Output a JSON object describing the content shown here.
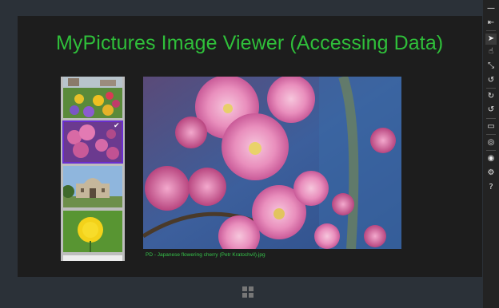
{
  "app": {
    "title": "MyPictures Image Viewer (Accessing Data)",
    "caption": "PD - Japanese flowering cherry (Petr Kratochvil).jpg"
  },
  "thumbnails": [
    {
      "name": "thumb-flower-garden",
      "selected": false
    },
    {
      "name": "thumb-japanese-cherry",
      "selected": true
    },
    {
      "name": "thumb-alamo-building",
      "selected": false
    },
    {
      "name": "thumb-yellow-dandelion",
      "selected": false
    }
  ],
  "toolbar": {
    "items": [
      {
        "name": "minimize-icon",
        "glyph": "—"
      },
      {
        "name": "pin-icon",
        "glyph": "⇤"
      },
      {
        "name": "pointer-icon",
        "glyph": "➤"
      },
      {
        "name": "touch-icon",
        "glyph": "☝"
      },
      {
        "name": "pinch-icon",
        "glyph": "⤡"
      },
      {
        "name": "rotate-touch-icon",
        "glyph": "↺"
      },
      {
        "name": "rotate-clockwise-icon",
        "glyph": "↻"
      },
      {
        "name": "rotate-counterclockwise-icon",
        "glyph": "↺"
      },
      {
        "name": "resolution-icon",
        "glyph": "▭"
      },
      {
        "name": "location-icon",
        "glyph": "◎"
      },
      {
        "name": "camera-icon",
        "glyph": "◉"
      },
      {
        "name": "settings-icon",
        "glyph": "⚙"
      },
      {
        "name": "help-icon",
        "glyph": "?"
      }
    ]
  },
  "colors": {
    "title": "#2fbf3a",
    "selection": "#6a2fd0",
    "background": "#1d1d1d"
  }
}
